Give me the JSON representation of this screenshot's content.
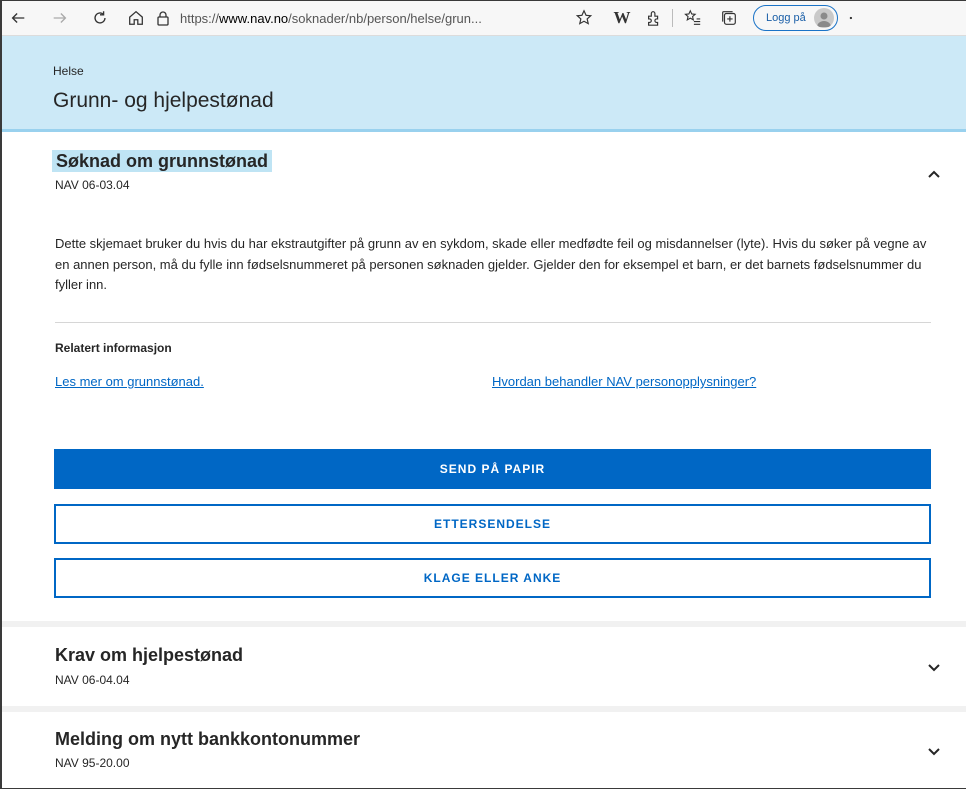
{
  "browser": {
    "url": "https://www.nav.no/soknader/nb/person/helse/grun...",
    "url_domain": "www.nav.no",
    "login_label": "Logg på"
  },
  "header": {
    "breadcrumb": "Helse",
    "title": "Grunn- og hjelpestønad"
  },
  "expanded_form": {
    "title": "Søknad om grunnstønad",
    "form_number": "NAV 06-03.04",
    "description": "Dette skjemaet bruker du hvis du har ekstrautgifter på grunn av en sykdom, skade eller medfødte feil og misdannelser (lyte). Hvis du søker på vegne av en annen person, må du fylle inn fødselsnummeret på personen søknaden gjelder. Gjelder den for eksempel et barn, er det barnets fødselsnummer du fyller inn.",
    "related_title": "Relatert informasjon",
    "links": [
      "Les mer om grunnstønad.",
      "Hvordan behandler NAV personopplysninger?"
    ],
    "buttons": {
      "send_paper": "SEND PÅ PAPIR",
      "ettersendelse": "ETTERSENDELSE",
      "klage": "KLAGE ELLER ANKE"
    }
  },
  "collapsed_forms": [
    {
      "title": "Krav om hjelpestønad",
      "form_number": "NAV 06-04.04"
    },
    {
      "title": "Melding om nytt bankkontonummer",
      "form_number": "NAV 95-20.00"
    }
  ],
  "colors": {
    "header_bg": "#cce9f7",
    "accent": "#0067c5",
    "highlight": "#bfe4f4"
  }
}
